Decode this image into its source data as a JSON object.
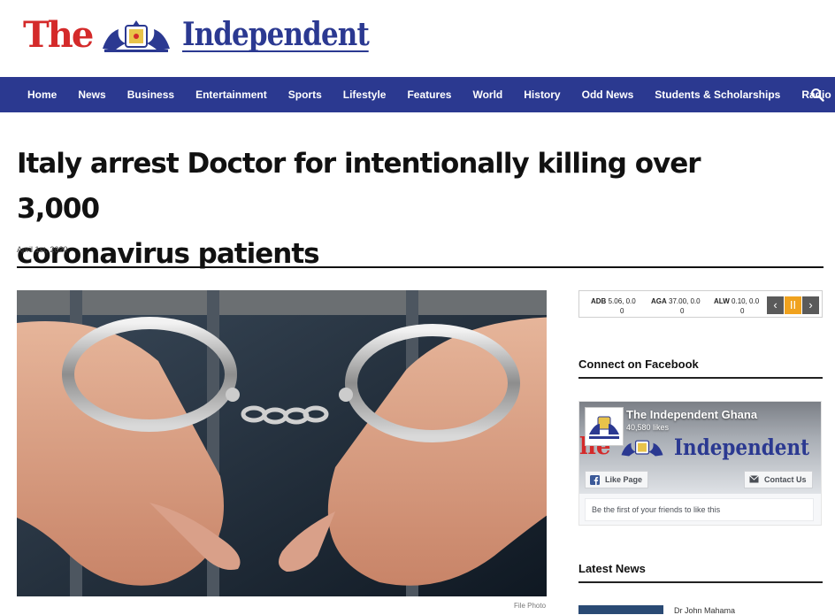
{
  "brand": {
    "the": "The",
    "wordmark": "Independent",
    "colors": {
      "red": "#d42a2a",
      "navy": "#2b3991"
    }
  },
  "nav": {
    "items": [
      "Home",
      "News",
      "Business",
      "Entertainment",
      "Sports",
      "Lifestyle",
      "Features",
      "World",
      "History",
      "Odd News",
      "Students & Scholarships",
      "Radio"
    ],
    "search_icon": "search-icon",
    "background": "#2b3990"
  },
  "article": {
    "headline_line1": "Italy arrest Doctor for intentionally killing over 3,000",
    "headline_line2": "coronavirus patients",
    "date": "April 1st, 2020",
    "image_caption": "File Photo"
  },
  "ticker": {
    "items": [
      {
        "symbol": "ADB",
        "value": "5.06, 0.0",
        "change": "0"
      },
      {
        "symbol": "AGA",
        "value": "37.00, 0.0",
        "change": "0"
      },
      {
        "symbol": "ALW",
        "value": "0.10, 0.0",
        "change": "0"
      }
    ],
    "prev": "‹",
    "pause": "II",
    "next": "›"
  },
  "sidebar": {
    "connect_heading": "Connect on Facebook",
    "latest_heading": "Latest News",
    "latest_snippet": "Dr John Mahama"
  },
  "facebook": {
    "page_name": "The Independent Ghana",
    "likes": "40,580 likes",
    "like_button": "Like Page",
    "contact_button": "Contact Us",
    "friends_text": "Be the first of your friends to like this",
    "cover_the": "he",
    "cover_word": "Independent"
  }
}
